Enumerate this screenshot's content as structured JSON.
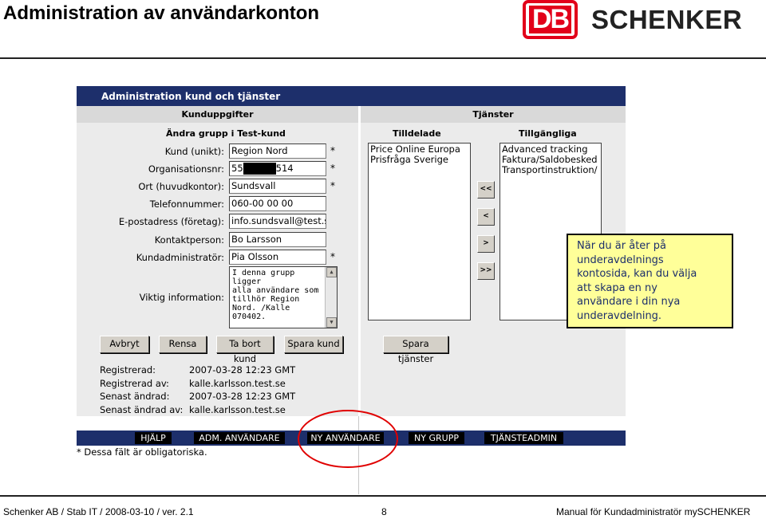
{
  "slide": {
    "title": "Administration av användarkonton",
    "logo_letters": "DB",
    "logo_word": "SCHENKER"
  },
  "app": {
    "window_title": "Administration kund och tjänster",
    "left_section": "Kunduppgifter",
    "group_heading": "Ändra grupp i Test-kund",
    "right_section": "Tjänster",
    "assigned_heading": "Tilldelade",
    "available_heading": "Tillgängliga",
    "fields": [
      {
        "label": "Kund (unikt):",
        "value": "Region Nord",
        "required": "*"
      },
      {
        "label": "Organisationsnr:",
        "value_pre": "55",
        "value_post": "514",
        "required": "*"
      },
      {
        "label": "Ort (huvudkontor):",
        "value": "Sundsvall",
        "required": "*"
      },
      {
        "label": "Telefonnummer:",
        "value": "060-00 00 00",
        "required": ""
      },
      {
        "label": "E-postadress (företag):",
        "value": "info.sundsvall@test.se",
        "required": ""
      },
      {
        "label": "Kontaktperson:",
        "value": "Bo Larsson",
        "required": ""
      },
      {
        "label": "Kundadministratör:",
        "value": "Pia Olsson",
        "required": "*"
      }
    ],
    "info_label": "Viktig information:",
    "info_lines": [
      "I denna grupp ligger",
      "alla användare som",
      "tillhör Region",
      "Nord. /Kalle 070402."
    ],
    "assigned_services": [
      "Price Online Europa",
      "Prisfråga Sverige"
    ],
    "available_services": [
      "Advanced tracking",
      "Faktura/Saldobesked",
      "Transportinstruktion/"
    ],
    "move_buttons": [
      "<<",
      "<",
      ">",
      ">>"
    ],
    "buttons": {
      "cancel": "Avbryt",
      "clear": "Rensa",
      "delete": "Ta bort kund",
      "save": "Spara kund",
      "save_services": "Spara tjänster"
    },
    "meta": [
      {
        "key": "Registrerad:",
        "value": "2007-03-28 12:23 GMT"
      },
      {
        "key": "Registrerad av:",
        "value": "kalle.karlsson.test.se"
      },
      {
        "key": "Senast ändrad:",
        "value": "2007-03-28 12:23 GMT"
      },
      {
        "key": "Senast ändrad av:",
        "value": "kalle.karlsson.test.se"
      }
    ],
    "nav": [
      "HJÄLP",
      "ADM. ANVÄNDARE",
      "NY ANVÄNDARE",
      "NY GRUPP",
      "TJÄNSTEADMIN"
    ],
    "footnote": "* Dessa fält är obligatoriska."
  },
  "callout": {
    "lines": [
      "När du är åter på",
      "underavdelnings",
      "kontosida, kan du välja",
      "att skapa en ny",
      "användare i din nya",
      "underavdelning."
    ]
  },
  "footer": {
    "left": "Schenker AB / Stab IT / 2008-03-10 / ver. 2.1",
    "page": "8",
    "right": "Manual för Kundadministratör mySCHENKER"
  },
  "colors": {
    "navy": "#1d2f6b",
    "db_red": "#e2001a",
    "callout_bg": "#ffff99",
    "highlight_ring": "#e00000"
  }
}
